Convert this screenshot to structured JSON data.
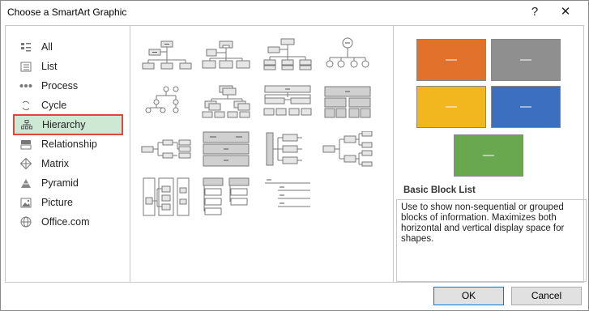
{
  "window": {
    "title": "Choose a SmartArt Graphic",
    "help": "?",
    "close": "✕"
  },
  "categories": [
    {
      "label": "All",
      "icon": "all-icon"
    },
    {
      "label": "List",
      "icon": "list-icon"
    },
    {
      "label": "Process",
      "icon": "process-icon"
    },
    {
      "label": "Cycle",
      "icon": "cycle-icon"
    },
    {
      "label": "Hierarchy",
      "icon": "hierarchy-icon",
      "selected": true
    },
    {
      "label": "Relationship",
      "icon": "relationship-icon"
    },
    {
      "label": "Matrix",
      "icon": "matrix-icon"
    },
    {
      "label": "Pyramid",
      "icon": "pyramid-icon"
    },
    {
      "label": "Picture",
      "icon": "picture-icon"
    },
    {
      "label": "Office.com",
      "icon": "office-icon"
    }
  ],
  "preview": {
    "title": "Basic Block List",
    "description": "Use to show non-sequential or grouped blocks of information. Maximizes both horizontal and vertical display space for shapes.",
    "block_colors": [
      "#e2712b",
      "#8f8f8f",
      "#f2b61f",
      "#3d6fc0",
      "#6aa84f"
    ]
  },
  "buttons": {
    "ok": "OK",
    "cancel": "Cancel"
  }
}
